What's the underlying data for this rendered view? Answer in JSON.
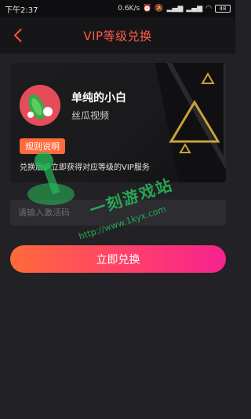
{
  "status_bar": {
    "time": "下午2:37",
    "net_speed": "0.6K/s",
    "battery": "48"
  },
  "nav": {
    "title": "VIP等级兑换"
  },
  "card": {
    "user_name": "单纯的小白",
    "app_name": "丝瓜视频",
    "rules_label": "规则说明",
    "description": "兑换后，立即获得对应等级的VIP服务"
  },
  "form": {
    "code_placeholder": "请输入激活码",
    "code_value": "",
    "redeem_label": "立即兑换"
  },
  "watermark": {
    "name": "一刻游戏站",
    "url": "http://www.1kyx.com"
  },
  "colors": {
    "accent": "#ff5b4a",
    "button_start": "#ff6b3a",
    "button_end": "#f5238e",
    "rules_badge": "#ff6a3d",
    "card_deco": "#c9a23a"
  }
}
